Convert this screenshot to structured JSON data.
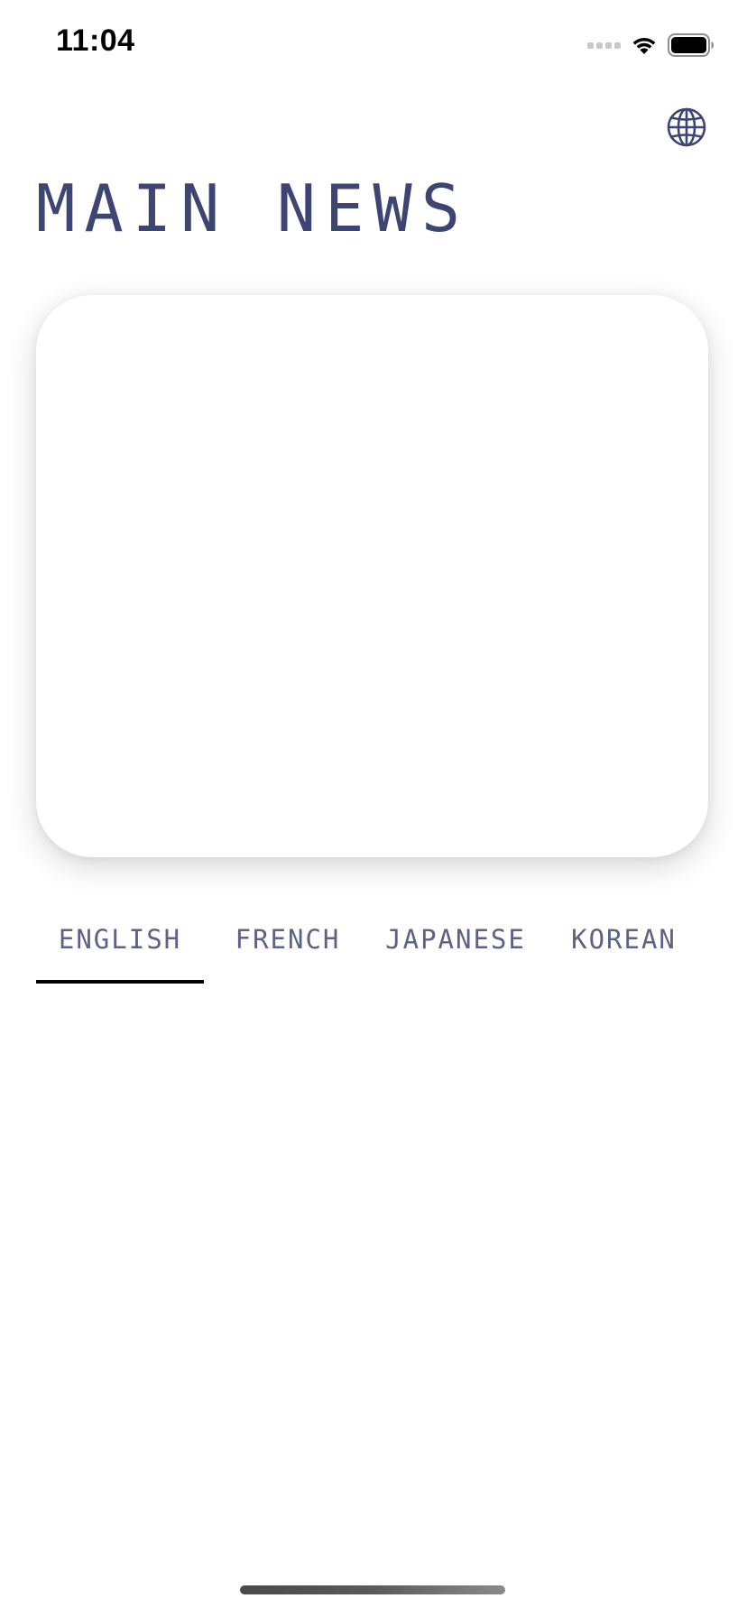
{
  "status_bar": {
    "time": "11:04",
    "icons": [
      "signal-icon",
      "wifi-icon",
      "battery-icon"
    ]
  },
  "header": {
    "title": "MAIN NEWS",
    "language_icon": "globe-icon"
  },
  "tabs": [
    {
      "label": "ENGLISH",
      "selected": true
    },
    {
      "label": "FRENCH",
      "selected": false
    },
    {
      "label": "JAPANESE",
      "selected": false
    },
    {
      "label": "KOREAN",
      "selected": false
    }
  ],
  "colors": {
    "accent": "#3d4573",
    "tab_text": "#5d6286",
    "indicator": "#000000",
    "background": "#ffffff"
  }
}
